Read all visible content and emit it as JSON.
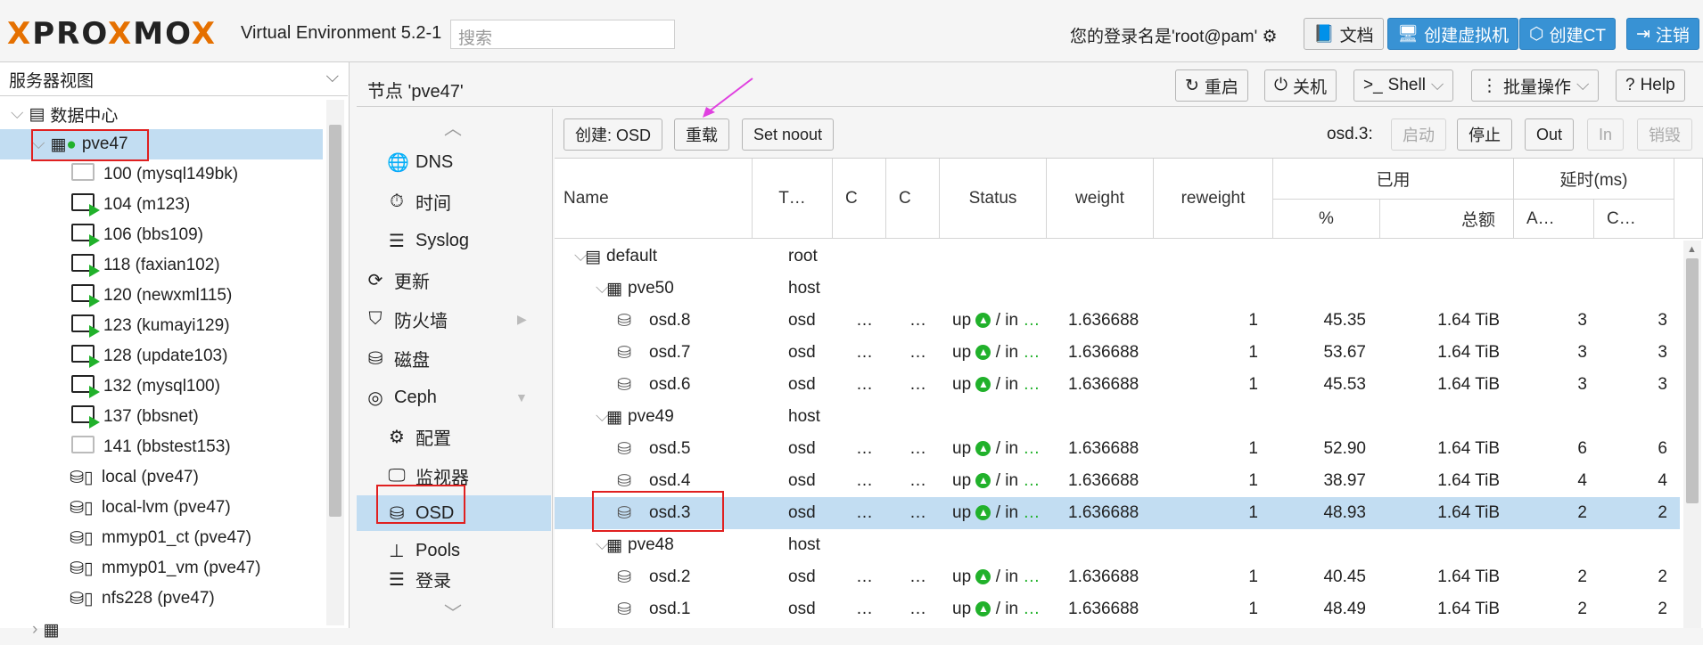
{
  "header": {
    "logo": "PROXMOX",
    "version": "Virtual Environment 5.2-1",
    "search_placeholder": "搜索",
    "login_text": "您的登录名是'root@pam'",
    "docs": "文档",
    "create_vm": "创建虚拟机",
    "create_ct": "创建CT",
    "logout": "注销"
  },
  "left": {
    "view": "服务器视图",
    "datacenter": "数据中心",
    "node": "pve47",
    "items": [
      "100 (mysql149bk)",
      "104 (m123)",
      "106 (bbs109)",
      "118 (faxian102)",
      "120 (newxml115)",
      "123 (kumayi129)",
      "128 (update103)",
      "132 (mysql100)",
      "137 (bbsnet)",
      "141 (bbstest153)",
      "local (pve47)",
      "local-lvm (pve47)",
      "mmyp01_ct (pve47)",
      "mmyp01_vm (pve47)",
      "nfs228 (pve47)"
    ],
    "running": [
      false,
      true,
      true,
      true,
      true,
      true,
      true,
      true,
      true,
      false
    ]
  },
  "panel": {
    "title": "节点 'pve47'",
    "restart": "重启",
    "shutdown": "关机",
    "shell": "Shell",
    "bulk": "批量操作",
    "help": "Help"
  },
  "nav": {
    "dns": "DNS",
    "time": "时间",
    "syslog": "Syslog",
    "update": "更新",
    "firewall": "防火墙",
    "disks": "磁盘",
    "ceph": "Ceph",
    "config": "配置",
    "monitor": "监视器",
    "osd": "OSD",
    "pools": "Pools",
    "log": "登录"
  },
  "osd_toolbar": {
    "create": "创建: OSD",
    "reload": "重载",
    "noout": "Set noout",
    "selected": "osd.3:",
    "start": "启动",
    "stop": "停止",
    "out": "Out",
    "in": "In",
    "destroy": "销毁"
  },
  "grid": {
    "headers": {
      "name": "Name",
      "type": "T…",
      "c1": "C",
      "c2": "C",
      "status": "Status",
      "weight": "weight",
      "reweight": "reweight",
      "used": "已用",
      "pct": "%",
      "total": "总额",
      "latency": "延时(ms)",
      "a": "A…",
      "c": "C…"
    },
    "rows": [
      {
        "name": "default",
        "type": "root",
        "kind": "root"
      },
      {
        "name": "pve50",
        "type": "host",
        "kind": "host"
      },
      {
        "name": "osd.8",
        "type": "osd",
        "kind": "osd",
        "status": "up",
        "in": "/ in",
        "weight": "1.636688",
        "reweight": "1",
        "pct": "45.35",
        "total": "1.64 TiB",
        "a": "3",
        "c": "3"
      },
      {
        "name": "osd.7",
        "type": "osd",
        "kind": "osd",
        "status": "up",
        "in": "/ in",
        "weight": "1.636688",
        "reweight": "1",
        "pct": "53.67",
        "total": "1.64 TiB",
        "a": "3",
        "c": "3"
      },
      {
        "name": "osd.6",
        "type": "osd",
        "kind": "osd",
        "status": "up",
        "in": "/ in",
        "weight": "1.636688",
        "reweight": "1",
        "pct": "45.53",
        "total": "1.64 TiB",
        "a": "3",
        "c": "3"
      },
      {
        "name": "pve49",
        "type": "host",
        "kind": "host"
      },
      {
        "name": "osd.5",
        "type": "osd",
        "kind": "osd",
        "status": "up",
        "in": "/ in",
        "weight": "1.636688",
        "reweight": "1",
        "pct": "52.90",
        "total": "1.64 TiB",
        "a": "6",
        "c": "6"
      },
      {
        "name": "osd.4",
        "type": "osd",
        "kind": "osd",
        "status": "up",
        "in": "/ in",
        "weight": "1.636688",
        "reweight": "1",
        "pct": "38.97",
        "total": "1.64 TiB",
        "a": "4",
        "c": "4"
      },
      {
        "name": "osd.3",
        "type": "osd",
        "kind": "osd",
        "status": "up",
        "in": "/ in",
        "weight": "1.636688",
        "reweight": "1",
        "pct": "48.93",
        "total": "1.64 TiB",
        "a": "2",
        "c": "2",
        "selected": true
      },
      {
        "name": "pve48",
        "type": "host",
        "kind": "host"
      },
      {
        "name": "osd.2",
        "type": "osd",
        "kind": "osd",
        "status": "up",
        "in": "/ in",
        "weight": "1.636688",
        "reweight": "1",
        "pct": "40.45",
        "total": "1.64 TiB",
        "a": "2",
        "c": "2"
      },
      {
        "name": "osd.1",
        "type": "osd",
        "kind": "osd",
        "status": "up",
        "in": "/ in",
        "weight": "1.636688",
        "reweight": "1",
        "pct": "48.49",
        "total": "1.64 TiB",
        "a": "2",
        "c": "2"
      }
    ]
  }
}
